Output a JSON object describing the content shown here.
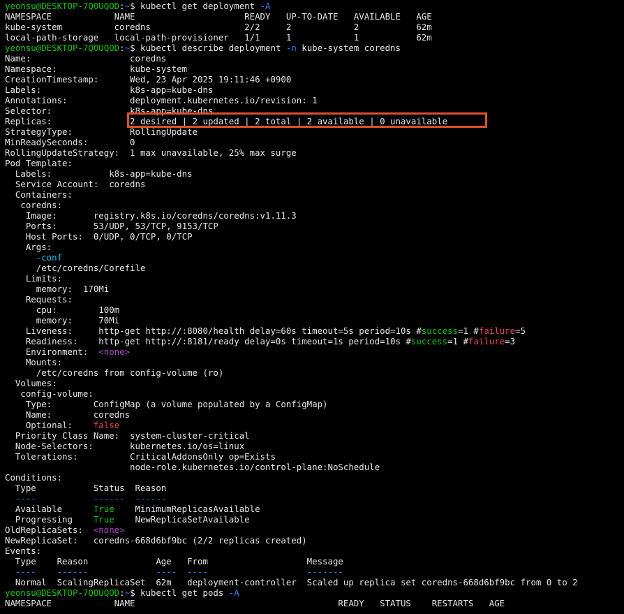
{
  "prompt": {
    "user_host": "yeonsu@DESKTOP-7Q0UQOD",
    "sep": ":",
    "path": "~",
    "dollar": "$ "
  },
  "cmd1": {
    "text": "kubectl get deployment ",
    "flag": "-A"
  },
  "table1": {
    "header": "NAMESPACE            NAME                     READY   UP-TO-DATE   AVAILABLE   AGE",
    "row1": "kube-system          coredns                  2/2     2            2           62m",
    "row2": "local-path-storage   local-path-provisioner   1/1     1            1           62m"
  },
  "cmd2": {
    "text_a": "kubectl describe deployment ",
    "flag": "-n",
    "text_b": " kube-system coredns"
  },
  "describe": {
    "l_name": "Name:                   coredns",
    "l_namespace": "Namespace:              kube-system",
    "l_created": "CreationTimestamp:      Wed, 23 Apr 2025 19:11:46 +0900",
    "l_labels": "Labels:                 k8s-app=kube-dns",
    "l_annotations": "Annotations:            deployment.kubernetes.io/revision: 1",
    "l_selector": "Selector:               k8s-app=kube-dns",
    "l_replicas_key": "Replicas:               ",
    "l_replicas_val": "2 desired | 2 updated | 2 total | 2 available | 0 unavailable",
    "l_strategy": "StrategyType:           RollingUpdate",
    "l_minready": "MinReadySeconds:        0",
    "l_rolling": "RollingUpdateStrategy:  1 max unavailable, 25% max surge",
    "l_podtemplate": "Pod Template:",
    "l_pt_labels": "  Labels:           k8s-app=kube-dns",
    "l_pt_sa": "  Service Account:  coredns",
    "l_containers": "  Containers:",
    "l_coredns": "   coredns:",
    "l_image": "    Image:       registry.k8s.io/coredns/coredns:v1.11.3",
    "l_ports": "    Ports:       53/UDP, 53/TCP, 9153/TCP",
    "l_hostports": "    Host Ports:  0/UDP, 0/TCP, 0/TCP",
    "l_args": "    Args:",
    "l_conf": "-conf",
    "l_conf_indent": "      ",
    "l_corefile": "      /etc/coredns/Corefile",
    "l_limits": "    Limits:",
    "l_limits_mem": "      memory:  170Mi",
    "l_requests": "    Requests:",
    "l_req_cpu": "      cpu:        100m",
    "l_req_mem": "      memory:     70Mi",
    "l_liveness_a": "    Liveness:     http-get http://:8080/health delay=60s timeout=5s period=10s ",
    "l_liveness_hash1": "#",
    "l_liveness_succ": "success",
    "l_liveness_mid": "=1 ",
    "l_liveness_hash2": "#",
    "l_liveness_fail": "failure",
    "l_liveness_end": "=5",
    "l_readiness_a": "    Readiness:    http-get http://:8181/ready delay=0s timeout=1s period=10s ",
    "l_readiness_hash1": "#",
    "l_readiness_succ": "success",
    "l_readiness_mid": "=1 ",
    "l_readiness_hash2": "#",
    "l_readiness_fail": "failure",
    "l_readiness_end": "=3",
    "l_env_key": "    Environment:  ",
    "l_env_val": "<none>",
    "l_mounts": "    Mounts:",
    "l_mount_path": "      /etc/coredns from config-volume (ro)",
    "l_volumes": "  Volumes:",
    "l_configvol": "   config-volume:",
    "l_vtype": "    Type:        ConfigMap (a volume populated by a ConfigMap)",
    "l_vname": "    Name:        coredns",
    "l_voptional_key": "    Optional:    ",
    "l_voptional_val": "false",
    "l_priority": "  Priority Class Name:  system-cluster-critical",
    "l_nodesel": "  Node-Selectors:       kubernetes.io/os=linux",
    "l_tolerations": "  Tolerations:          CriticalAddonsOnly op=Exists",
    "l_tolerations2": "                        node-role.kubernetes.io/control-plane:NoSchedule",
    "l_conditions": "Conditions:",
    "l_cond_header": "  Type           Status  Reason",
    "l_cond_sep_a": "  ----           ",
    "l_cond_sep_b": "------",
    "l_cond_sep_c": "  ",
    "l_cond_sep_d": "------",
    "l_cond_avail_a": "  Available      ",
    "l_cond_avail_b": "True",
    "l_cond_avail_c": "    MinimumReplicasAvailable",
    "l_cond_prog_a": "  Progressing    ",
    "l_cond_prog_b": "True",
    "l_cond_prog_c": "    NewReplicaSetAvailable",
    "l_oldrs_key": "OldReplicaSets:  ",
    "l_oldrs_val": "<none>",
    "l_newrs": "NewReplicaSet:   coredns-668d6bf9bc (2/2 replicas created)",
    "l_events": "Events:",
    "l_ev_header": "  Type    Reason             Age   From                   Message",
    "l_ev_sep_a": "  ",
    "l_ev_sep_b": "----    ------             ----  ----                   -------",
    "l_ev_row": "  Normal  ScalingReplicaSet  62m   deployment-controller  Scaled up replica set coredns-668d6bf9bc from 0 to 2"
  },
  "cmd3": {
    "text": "kubectl get pods ",
    "flag": "-A"
  },
  "table3": {
    "header": "NAMESPACE            NAME                                       READY   STATUS    RESTARTS   AGE"
  },
  "colors": {
    "prompt_user": "#16c60c",
    "prompt_path": "#3b78ff",
    "flag": "#3b78ff",
    "false_value": "#e74856",
    "none_value": "#b148c6",
    "conf_value": "#16c6e6",
    "highlight_border": "#e0512b"
  }
}
